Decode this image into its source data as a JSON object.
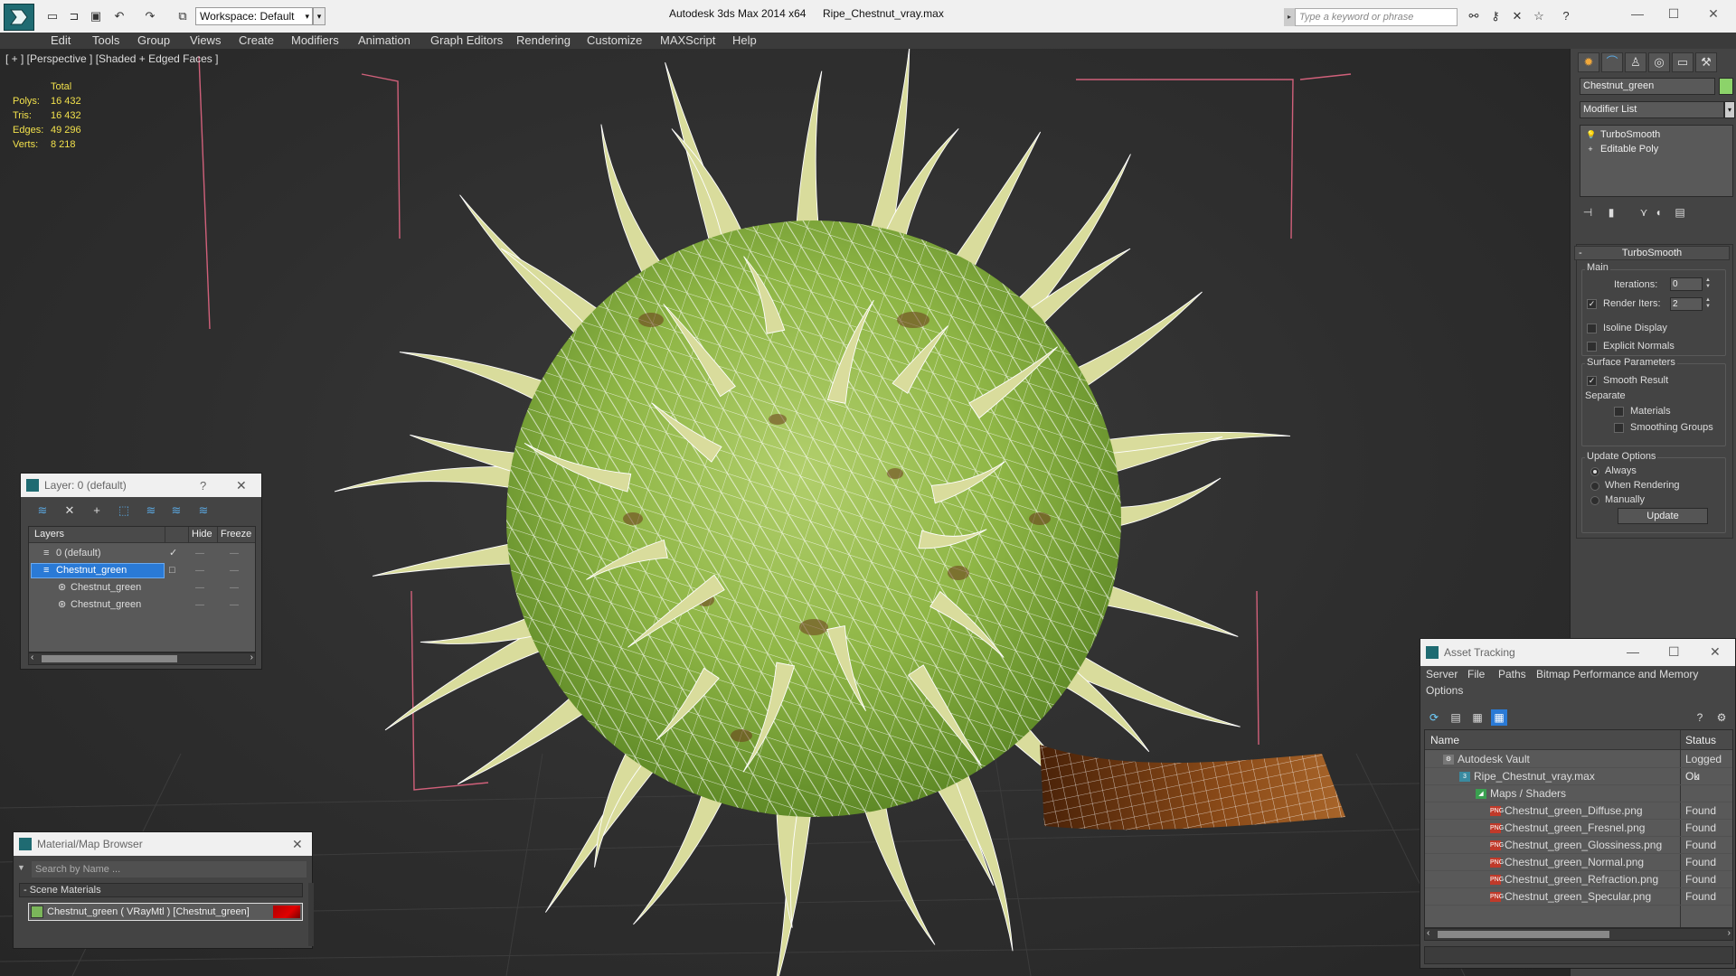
{
  "titlebar": {
    "workspace": "Workspace: Default",
    "app_title": "Autodesk 3ds Max  2014 x64",
    "file_name": "Ripe_Chestnut_vray.max",
    "search_placeholder": "Type a keyword or phrase"
  },
  "menu": [
    "Edit",
    "Tools",
    "Group",
    "Views",
    "Create",
    "Modifiers",
    "Animation",
    "Graph Editors",
    "Rendering",
    "Customize",
    "MAXScript",
    "Help"
  ],
  "viewport": {
    "label": "[ + ] [Perspective ] [Shaded + Edged Faces ]",
    "stats": {
      "header": "Total",
      "rows": [
        {
          "label": "Polys:",
          "value": "16 432"
        },
        {
          "label": "Tris:",
          "value": "16 432"
        },
        {
          "label": "Edges:",
          "value": "49 296"
        },
        {
          "label": "Verts:",
          "value": "8 218"
        }
      ]
    },
    "colors": {
      "mesh_green": "#8fb646",
      "wire": "#ffffff",
      "stem_brown": "#7a3f13",
      "bounds": "#d0607a",
      "stats_yellow": "#f2e14c"
    }
  },
  "command_panel": {
    "object_name": "Chestnut_green",
    "object_color": "#8cd36a",
    "modifier_list": "Modifier List",
    "stack": [
      "TurboSmooth",
      "Editable Poly"
    ],
    "turbosmooth": {
      "title": "TurboSmooth",
      "main_label": "Main",
      "iterations_label": "Iterations:",
      "iterations_value": "0",
      "render_iters_label": "Render Iters:",
      "render_iters_value": "2",
      "render_iters_checked": true,
      "isoline_label": "Isoline Display",
      "explicit_label": "Explicit Normals",
      "surface_label": "Surface Parameters",
      "smooth_label": "Smooth Result",
      "separate_label": "Separate",
      "materials_label": "Materials",
      "smoothing_label": "Smoothing Groups",
      "update_options_label": "Update Options",
      "always_label": "Always",
      "when_rendering_label": "When Rendering",
      "manually_label": "Manually",
      "update_button": "Update"
    }
  },
  "layer_dialog": {
    "title": "Layer: 0 (default)",
    "help": "?",
    "close": "✕",
    "columns": {
      "layers": "Layers",
      "hide": "Hide",
      "freeze": "Freeze"
    },
    "rows": [
      {
        "name": "0 (default)",
        "indent": 1,
        "selected": false,
        "check": "✓"
      },
      {
        "name": "Chestnut_green",
        "indent": 1,
        "selected": true,
        "check": "□"
      },
      {
        "name": "Chestnut_green",
        "indent": 2,
        "selected": false,
        "check": ""
      },
      {
        "name": "Chestnut_green",
        "indent": 2,
        "selected": false,
        "check": ""
      }
    ]
  },
  "material_browser": {
    "title": "Material/Map Browser",
    "close": "✕",
    "search_placeholder": "Search by Name ...",
    "section": "- Scene Materials",
    "material": "Chestnut_green  ( VRayMtl )  [Chestnut_green]"
  },
  "asset_tracking": {
    "title": "Asset Tracking",
    "menu": [
      "Server",
      "File",
      "Paths",
      "Bitmap Performance and Memory",
      "Options"
    ],
    "columns": {
      "name": "Name",
      "status": "Status"
    },
    "rows": [
      {
        "name": "Autodesk Vault",
        "status": "Logged Ou",
        "indent": 0,
        "icon": "vault-icon"
      },
      {
        "name": "Ripe_Chestnut_vray.max",
        "status": "Ok",
        "indent": 1,
        "icon": "max-file-icon"
      },
      {
        "name": "Maps / Shaders",
        "status": "",
        "indent": 2,
        "icon": "maps-icon"
      },
      {
        "name": "Chestnut_green_Diffuse.png",
        "status": "Found",
        "indent": 3,
        "icon": "png-icon"
      },
      {
        "name": "Chestnut_green_Fresnel.png",
        "status": "Found",
        "indent": 3,
        "icon": "png-icon"
      },
      {
        "name": "Chestnut_green_Glossiness.png",
        "status": "Found",
        "indent": 3,
        "icon": "png-icon"
      },
      {
        "name": "Chestnut_green_Normal.png",
        "status": "Found",
        "indent": 3,
        "icon": "png-icon"
      },
      {
        "name": "Chestnut_green_Refraction.png",
        "status": "Found",
        "indent": 3,
        "icon": "png-icon"
      },
      {
        "name": "Chestnut_green_Specular.png",
        "status": "Found",
        "indent": 3,
        "icon": "png-icon"
      }
    ]
  }
}
